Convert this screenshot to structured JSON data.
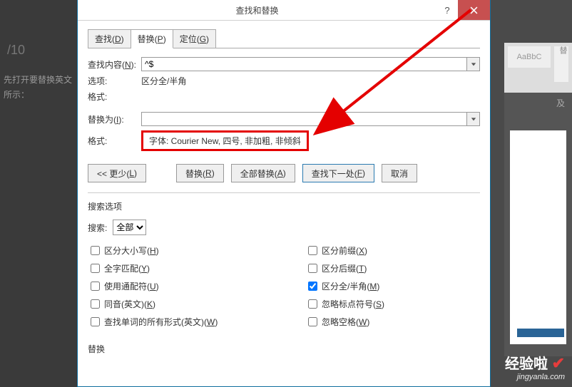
{
  "bgLeft": {
    "counter": "/10",
    "line1": "先打开要替换英文",
    "line2": "所示："
  },
  "bgRight": {
    "styleSample": "AaBbC",
    "stroke": "替",
    "sidebarLabel": "及"
  },
  "dialog": {
    "title": "查找和替换",
    "tabs": {
      "find": {
        "pre": "查找(",
        "u": "D",
        "post": ")"
      },
      "replace": {
        "pre": "替换(",
        "u": "P",
        "post": ")"
      },
      "goto": {
        "pre": "定位(",
        "u": "G",
        "post": ")"
      }
    },
    "labels": {
      "findWhat": {
        "pre": "查找内容(",
        "u": "N",
        "post": "):"
      },
      "options": "选项:",
      "format": "格式:",
      "replaceWith": {
        "pre": "替换为(",
        "u": "I",
        "post": "):"
      },
      "optionsVal": "区分全/半角",
      "formatBox": "字体: Courier New, 四号, 非加粗, 非倾斜"
    },
    "findValue": "^$",
    "replaceValue": "",
    "buttons": {
      "less": {
        "pre": "<< 更少(",
        "u": "L",
        "post": ")"
      },
      "replace": {
        "pre": "替换(",
        "u": "R",
        "post": ")"
      },
      "replaceAll": {
        "pre": "全部替换(",
        "u": "A",
        "post": ")"
      },
      "findNext": {
        "pre": "查找下一处(",
        "u": "F",
        "post": ")"
      },
      "cancel": "取消"
    },
    "searchOpts": {
      "group": "搜索选项",
      "searchLabel": "搜索:",
      "searchSel": "全部",
      "left": {
        "matchCase": {
          "pre": "区分大小写(",
          "u": "H",
          "post": ")"
        },
        "wholeWord": {
          "pre": "全字匹配(",
          "u": "Y",
          "post": ")"
        },
        "wildcards": {
          "pre": "使用通配符(",
          "u": "U",
          "post": ")"
        },
        "soundsLike": {
          "pre": "同音(英文)(",
          "u": "K",
          "post": ")"
        },
        "allForms": {
          "pre": "查找单词的所有形式(英文)(",
          "u": "W",
          "post": ")"
        }
      },
      "right": {
        "prefix": {
          "pre": "区分前缀(",
          "u": "X",
          "post": ")"
        },
        "suffix": {
          "pre": "区分后缀(",
          "u": "T",
          "post": ")"
        },
        "fullHalf": {
          "pre": "区分全/半角(",
          "u": "M",
          "post": ")"
        },
        "ignorePunct": {
          "pre": "忽略标点符号(",
          "u": "S",
          "post": ")"
        },
        "ignoreSpace": {
          "pre": "忽略空格(",
          "u": "W",
          "post": ")"
        }
      }
    },
    "bottomSect": "替换"
  },
  "watermark": {
    "l1": "经验啦",
    "l2": "jingyanla.com"
  }
}
